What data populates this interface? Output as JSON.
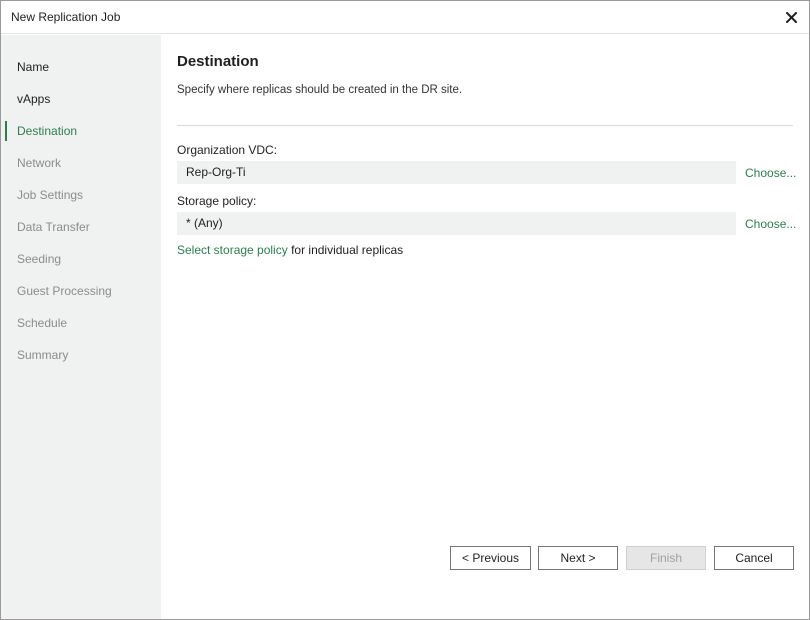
{
  "window": {
    "title": "New Replication Job",
    "close_icon": "close-icon"
  },
  "sidebar": {
    "steps": [
      {
        "label": "Name",
        "state": "done"
      },
      {
        "label": "vApps",
        "state": "done"
      },
      {
        "label": "Destination",
        "state": "active"
      },
      {
        "label": "Network",
        "state": "pending"
      },
      {
        "label": "Job Settings",
        "state": "pending"
      },
      {
        "label": "Data Transfer",
        "state": "pending"
      },
      {
        "label": "Seeding",
        "state": "pending"
      },
      {
        "label": "Guest Processing",
        "state": "pending"
      },
      {
        "label": "Schedule",
        "state": "pending"
      },
      {
        "label": "Summary",
        "state": "pending"
      }
    ]
  },
  "main": {
    "title": "Destination",
    "description": "Specify where replicas should be created in the DR site.",
    "org_vdc": {
      "label": "Organization VDC:",
      "value": "Rep-Org-Ti",
      "choose_label": "Choose..."
    },
    "storage_policy": {
      "label": "Storage policy:",
      "value": "* (Any)",
      "choose_label": "Choose..."
    },
    "policy_link": {
      "link_text": "Select storage policy",
      "suffix_text": " for individual replicas"
    }
  },
  "footer": {
    "previous_label": "< Previous",
    "next_label": "Next >",
    "finish_label": "Finish",
    "cancel_label": "Cancel"
  },
  "colors": {
    "accent": "#2e7d4f",
    "sidebar_bg": "#f0f1f1",
    "pending_text": "#8c8c8c"
  }
}
